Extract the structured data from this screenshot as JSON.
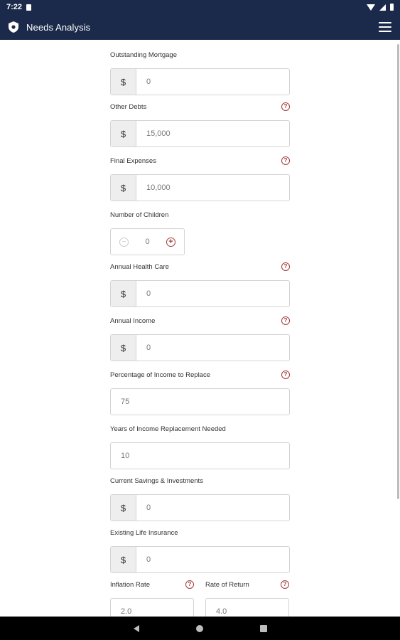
{
  "status_bar": {
    "time": "7:22"
  },
  "app_bar": {
    "title": "Needs Analysis"
  },
  "fields": {
    "mortgage": {
      "label": "Outstanding Mortgage",
      "prefix": "$",
      "value": "0"
    },
    "other_debts": {
      "label": "Other Debts",
      "prefix": "$",
      "value": "15,000",
      "help": "?"
    },
    "final_expenses": {
      "label": "Final Expenses",
      "prefix": "$",
      "value": "10,000",
      "help": "?"
    },
    "children": {
      "label": "Number of Children",
      "value": "0",
      "minus": "−",
      "plus": "+"
    },
    "health_care": {
      "label": "Annual Health Care",
      "prefix": "$",
      "value": "0",
      "help": "?"
    },
    "income": {
      "label": "Annual Income",
      "prefix": "$",
      "value": "0",
      "help": "?"
    },
    "pct_replace": {
      "label": "Percentage of Income to Replace",
      "value": "75",
      "help": "?"
    },
    "years": {
      "label": "Years of Income Replacement Needed",
      "value": "10"
    },
    "savings": {
      "label": "Current Savings & Investments",
      "prefix": "$",
      "value": "0"
    },
    "life_insurance": {
      "label": "Existing Life Insurance",
      "prefix": "$",
      "value": "0"
    },
    "inflation": {
      "label": "Inflation Rate",
      "value": "2.0",
      "help": "?"
    },
    "return": {
      "label": "Rate of Return",
      "value": "4.0",
      "help": "?"
    }
  },
  "colors": {
    "app_bar": "#1b2a4a",
    "accent": "#a33a3a"
  }
}
